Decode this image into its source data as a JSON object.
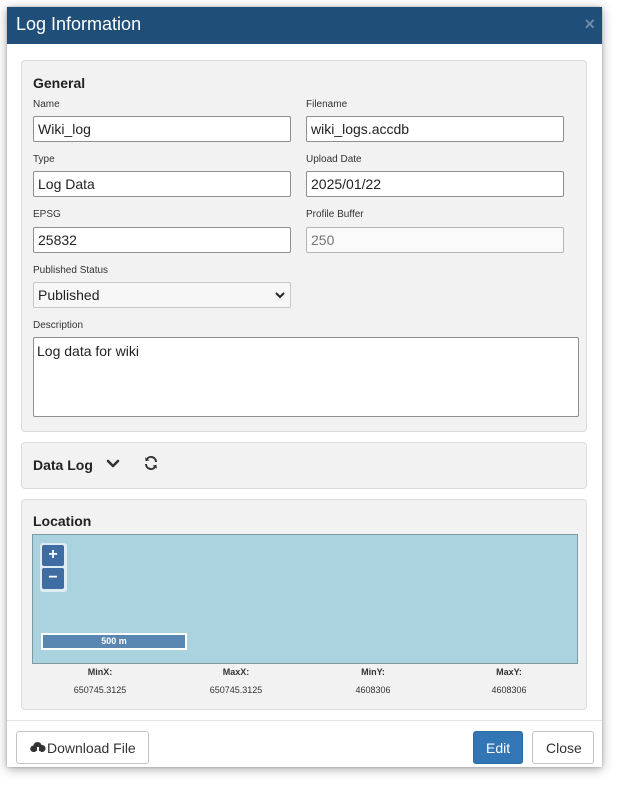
{
  "dialog": {
    "title": "Log Information",
    "close_icon": "×"
  },
  "general": {
    "heading": "General",
    "name_label": "Name",
    "name_value": "Wiki_log",
    "filename_label": "Filename",
    "filename_value": "wiki_logs.accdb",
    "type_label": "Type",
    "type_value": "Log Data",
    "upload_date_label": "Upload Date",
    "upload_date_value": "2025/01/22",
    "epsg_label": "EPSG",
    "epsg_value": "25832",
    "profile_buffer_label": "Profile Buffer",
    "profile_buffer_placeholder": "250",
    "published_status_label": "Published Status",
    "published_status_value": "Published",
    "description_label": "Description",
    "description_value": "Log data for wiki"
  },
  "data_log": {
    "heading": "Data Log"
  },
  "location": {
    "heading": "Location",
    "zoom_in": "+",
    "zoom_out": "−",
    "scale_label": "500 m",
    "minx_label": "MinX:",
    "minx_value": "650745.3125",
    "maxx_label": "MaxX:",
    "maxx_value": "650745.3125",
    "miny_label": "MinY:",
    "miny_value": "4608306",
    "maxy_label": "MaxY:",
    "maxy_value": "4608306"
  },
  "footer": {
    "download_label": "Download File",
    "edit_label": "Edit",
    "close_label": "Close"
  },
  "icons": {
    "cloud_download": "cloud-download-icon",
    "chevron_down": "chevron-down-icon",
    "refresh": "refresh-icon"
  },
  "colors": {
    "titlebar": "#1f4e79",
    "primary": "#3276b6",
    "map_water": "#aad3df"
  }
}
